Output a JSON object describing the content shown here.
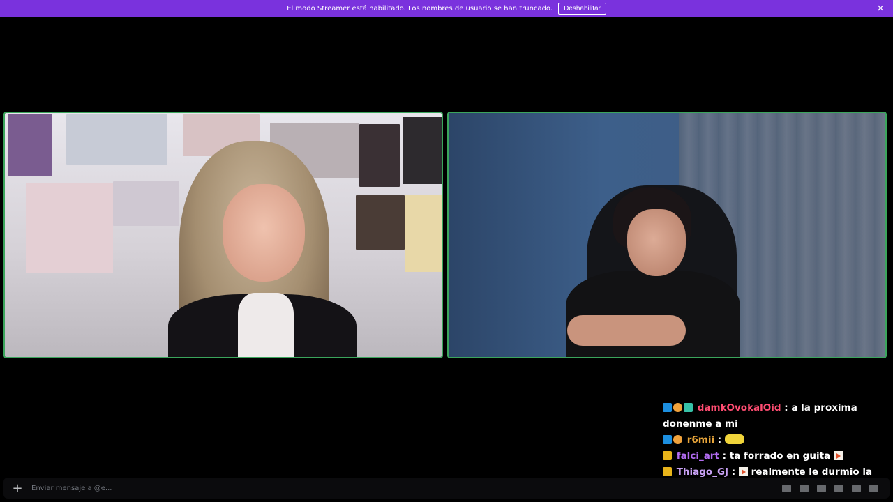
{
  "banner": {
    "message": "El modo Streamer está habilitado. Los nombres de usuario se han truncado.",
    "button_label": "Deshabilitar",
    "close_glyph": "×"
  },
  "composer": {
    "placeholder": "Enviar mensaje a @e...",
    "add_glyph": "+"
  },
  "chat": {
    "messages": [
      {
        "user": "damkOvokalOid",
        "user_color": "#ff4d72",
        "text": "a la proxima donenme a mi",
        "badges": [
          "arrow-badge",
          "burst-badge",
          "gift-badge"
        ]
      },
      {
        "user": "r6mii",
        "user_color": "#e8a53a",
        "text": "",
        "emote": "car-emote",
        "badges": [
          "arrow-badge",
          "burst-badge"
        ]
      },
      {
        "user": "falci_art",
        "user_color": "#b36cf2",
        "text": "ta forrado en guita",
        "badges": [
          "crown-badge"
        ]
      },
      {
        "user": "Thiago_GJ",
        "user_color": "#c9a2f5",
        "text": "realmente le durmio la jubilacion a la abuela",
        "badges": [
          "crown-badge"
        ]
      }
    ]
  },
  "colors": {
    "banner": "#7a32dd",
    "speaking_border": "#3ba55c"
  }
}
